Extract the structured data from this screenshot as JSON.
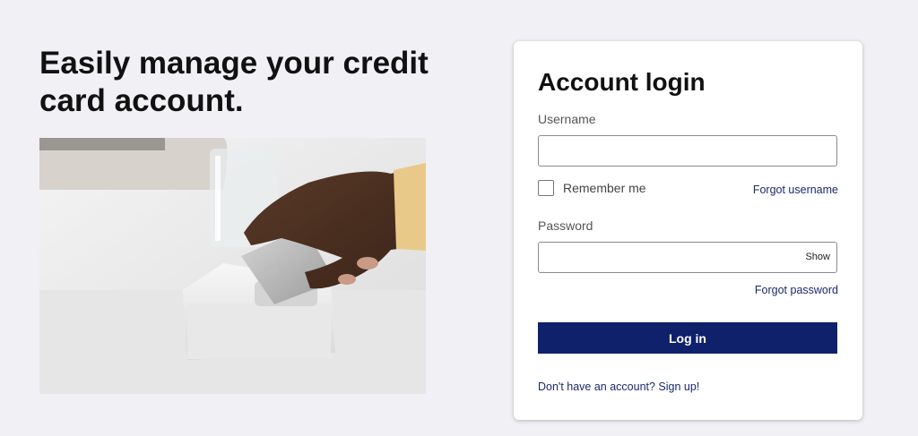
{
  "hero": {
    "headline": "Easily manage your credit card account."
  },
  "login": {
    "title": "Account login",
    "username_label": "Username",
    "username_value": "",
    "remember_label": "Remember me",
    "remember_checked": false,
    "forgot_username": "Forgot username",
    "password_label": "Password",
    "password_value": "",
    "show_label": "Show",
    "forgot_password": "Forgot password",
    "login_button": "Log in",
    "signup_link": "Don't have an account? Sign up!"
  },
  "colors": {
    "page_bg": "#f1f0f5",
    "button_bg": "#0f216b",
    "link": "#1a2a6c"
  }
}
